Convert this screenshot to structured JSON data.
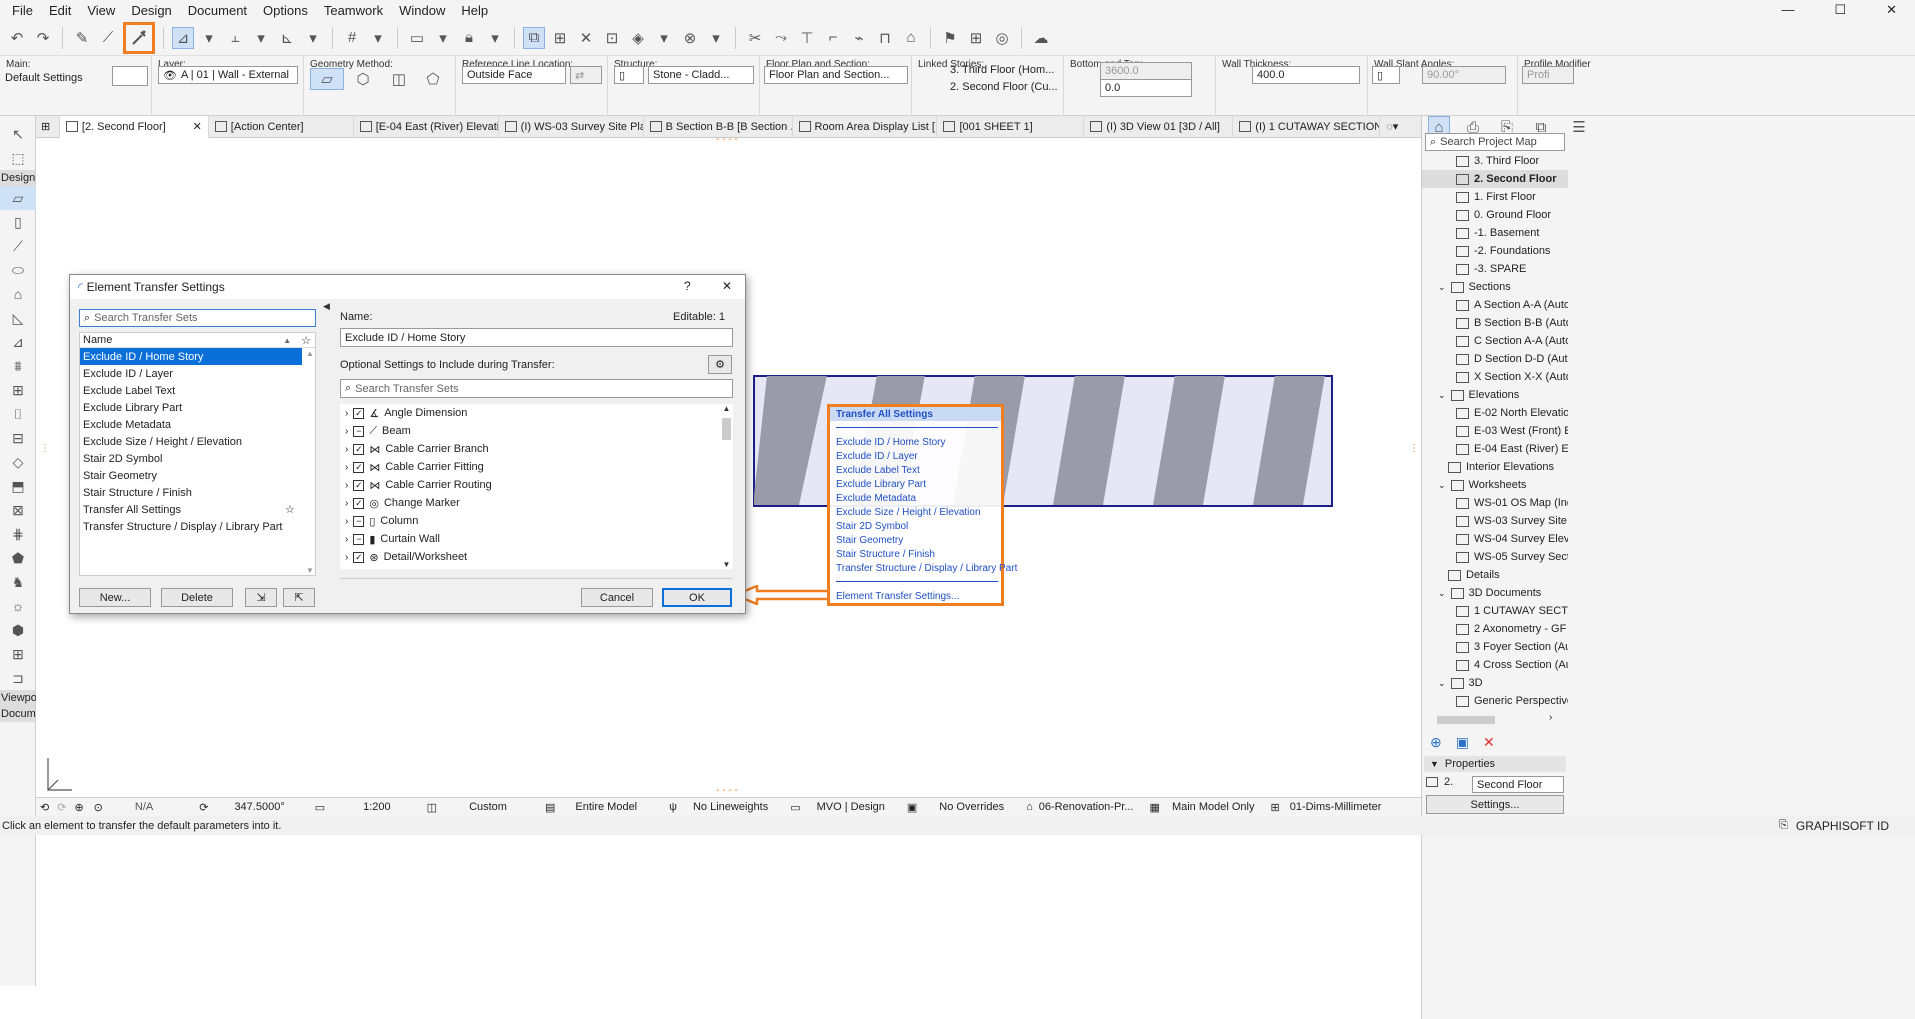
{
  "menu": [
    "File",
    "Edit",
    "View",
    "Design",
    "Document",
    "Options",
    "Teamwork",
    "Window",
    "Help"
  ],
  "window_controls": [
    "—",
    "☐",
    "✕"
  ],
  "infobox": {
    "main_label": "Main:",
    "main_value": "Default Settings",
    "layer_label": "Layer:",
    "layer_value": "A | 01 | Wall - External",
    "geometry_label": "Geometry Method:",
    "refline_label": "Reference Line Location:",
    "refline_value": "Outside Face",
    "structure_label": "Structure:",
    "structure_value": "Stone - Cladd...",
    "floorplan_label": "Floor Plan and Section:",
    "floorplan_value": "Floor Plan and Section...",
    "linked_label": "Linked Stories:",
    "linked_top": "3. Third Floor (Hom...",
    "linked_bottom": "2. Second Floor (Cu...",
    "bottomtop_label": "Bottom and Top:",
    "top_value": "3600.0",
    "bottom_value": "0.0",
    "thickness_label": "Wall Thickness:",
    "thickness_value": "400.0",
    "slant_label": "Wall Slant Angles:",
    "slant_value": "90.00°",
    "profile_label": "Profile Modifier",
    "profile_value": "Profi"
  },
  "tabs": [
    "[2. Second Floor]",
    "[Action Center]",
    "[E-04 East (River) Elevatio...",
    "(I) WS-03 Survey Site Pla...",
    "B Section B-B [B Section ...",
    "Room Area Display List [...",
    "[001 SHEET 1]",
    "(I) 3D View 01 [3D / All]",
    "(I) 1 CUTAWAY SECTION 1..."
  ],
  "toolbox": {
    "design_header": "Design",
    "viewpoint_header": "Viewpoi",
    "document_header": "Docume"
  },
  "navigator": {
    "search_placeholder": "Search Project Map",
    "items": [
      "3. Third Floor",
      "2. Second Floor",
      "1. First Floor",
      "0. Ground Floor",
      "-1. Basement",
      "-2. Foundations",
      "-3. SPARE",
      "Sections",
      "A Section A-A (Auto",
      "B Section B-B (Auto-",
      "C Section A-A (Auto",
      "D Section D-D (Aut",
      "X Section X-X (Auto",
      "Elevations",
      "E-02 North Elevatio",
      "E-03 West (Front) El",
      "E-04 East (River) Ele",
      "Interior Elevations",
      "Worksheets",
      "WS-01 OS Map (Ind",
      "WS-03 Survey Site P",
      "WS-04 Survey Eleva",
      "WS-05 Survey Sectio",
      "Details",
      "3D Documents",
      "1 CUTAWAY SECTION",
      "2 Axonometry - GF (",
      "3 Foyer Section (Au",
      "4 Cross Section (Au",
      "3D",
      "Generic Perspective"
    ],
    "properties_label": "Properties",
    "prop_id": "2.",
    "prop_name": "Second Floor",
    "settings_button": "Settings...",
    "brand": "GRAPHISOFT ID"
  },
  "dialog": {
    "title": "Element Transfer Settings",
    "help": "?",
    "close": "✕",
    "search_placeholder": "Search Transfer Sets",
    "name_col": "Name",
    "sets": [
      "Exclude ID / Home Story",
      "Exclude ID / Layer",
      "Exclude Label Text",
      "Exclude Library Part",
      "Exclude Metadata",
      "Exclude Size / Height / Elevation",
      "Stair 2D Symbol",
      "Stair Geometry",
      "Stair Structure / Finish",
      "Transfer All Settings",
      "Transfer Structure / Display / Library Part"
    ],
    "new_button": "New...",
    "delete_button": "Delete",
    "name_label": "Name:",
    "editable_label": "Editable: 1",
    "name_value": "Exclude ID / Home Story",
    "optional_label": "Optional Settings to Include during Transfer:",
    "search2_placeholder": "Search Transfer Sets",
    "tree": [
      {
        "label": "Angle Dimension",
        "state": "checked"
      },
      {
        "label": "Beam",
        "state": "partial"
      },
      {
        "label": "Cable Carrier Branch",
        "state": "checked"
      },
      {
        "label": "Cable Carrier Fitting",
        "state": "checked"
      },
      {
        "label": "Cable Carrier Routing",
        "state": "checked"
      },
      {
        "label": "Change Marker",
        "state": "checked"
      },
      {
        "label": "Column",
        "state": "partial"
      },
      {
        "label": "Curtain Wall",
        "state": "partial"
      },
      {
        "label": "Detail/Worksheet",
        "state": "checked"
      }
    ],
    "cancel_button": "Cancel",
    "ok_button": "OK"
  },
  "popup": {
    "header": "Transfer All Settings",
    "items": [
      "Exclude ID / Home Story",
      "Exclude ID / Layer",
      "Exclude Label Text",
      "Exclude Library Part",
      "Exclude Metadata",
      "Exclude Size / Height / Elevation",
      "Stair 2D Symbol",
      "Stair Geometry",
      "Stair Structure / Finish",
      "Transfer Structure / Display / Library Part"
    ],
    "footer": "Element Transfer Settings..."
  },
  "bottombar": {
    "na": "N/A",
    "angle": "347.5000°",
    "scale": "1:200",
    "pen": "Custom",
    "model": "Entire Model",
    "lineweights": "No Lineweights",
    "mvo": "MVO | Design",
    "overrides": "No Overrides",
    "renovation": "06-Renovation-Pr...",
    "main_model": "Main Model Only",
    "dims": "01-Dims-Millimeter"
  },
  "status_text": "Click an element to transfer the default parameters into it.",
  "colors": {
    "accent_orange": "#ef7d22",
    "selection_blue": "#0a6fd8",
    "link_blue": "#1f4fc4",
    "wall_stripe": "#9a9aa8",
    "wall_fill": "#e6e6f5",
    "wall_outline": "#1b1f8a"
  }
}
